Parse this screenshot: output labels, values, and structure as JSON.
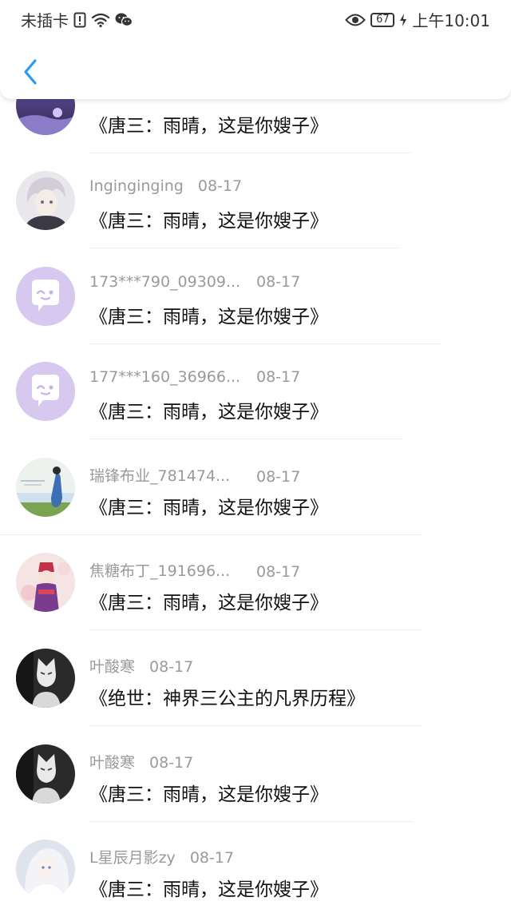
{
  "status_bar": {
    "carrier": "未插卡",
    "battery": "67",
    "time": "上午10:01"
  },
  "colors": {
    "accent": "#2b9af3",
    "meta_text": "#9a9a9a",
    "title_text": "#111111"
  },
  "comments": [
    {
      "name": "",
      "date": "",
      "title": "《唐三：雨晴，这是你嫂子》",
      "avatar": "purple-scene"
    },
    {
      "name": "Inginginging",
      "date": "08-17",
      "title": "《唐三：雨晴，这是你嫂子》",
      "avatar": "anime-boy"
    },
    {
      "name": "173***790_09309...",
      "date": "08-17",
      "title": "《唐三：雨晴，这是你嫂子》",
      "avatar": "default-chat"
    },
    {
      "name": "177***160_36966...",
      "date": "08-17",
      "title": "《唐三：雨晴，这是你嫂子》",
      "avatar": "default-chat"
    },
    {
      "name": "瑞锋布业_781474...",
      "date": "08-17",
      "title": "《唐三：雨晴，这是你嫂子》",
      "avatar": "girl-landscape"
    },
    {
      "name": "焦糖布丁_191696...",
      "date": "08-17",
      "title": "《唐三：雨晴，这是你嫂子》",
      "avatar": "costume-girl"
    },
    {
      "name": "叶酸寒",
      "date": "08-17",
      "title": "《绝世：神界三公主的凡界历程》",
      "avatar": "fox-mask"
    },
    {
      "name": "叶酸寒",
      "date": "08-17",
      "title": "《唐三：雨晴，这是你嫂子》",
      "avatar": "fox-mask"
    },
    {
      "name": "L星辰月影zy",
      "date": "08-17",
      "title": "《唐三：雨晴，这是你嫂子》",
      "avatar": "white-hair-girl"
    }
  ]
}
